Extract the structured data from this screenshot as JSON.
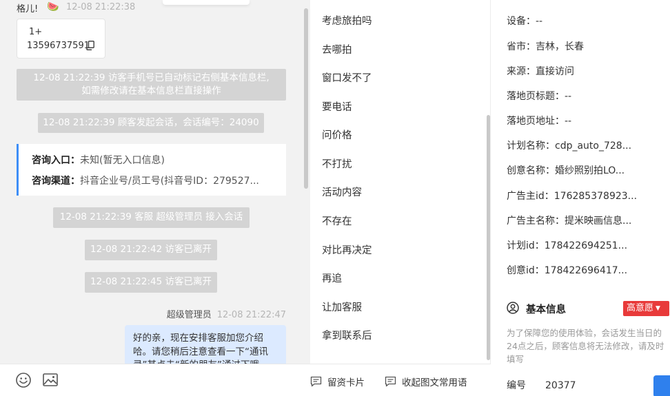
{
  "chat": {
    "visitor_name": "格儿!",
    "visitor_emoji": "🍉",
    "visitor_time": "12-08 21:22:38",
    "phone_prefix": "1+",
    "phone_number": "13596737591",
    "system_messages": [
      {
        "line1": "12-08 21:22:39 访客手机号已自动标记右侧基本信息栏,",
        "line2": "如需修改请在基本信息栏直接操作"
      },
      {
        "line1": "12-08 21:22:39 顾客发起会话，会话编号：24090"
      },
      {
        "line1": "12-08 21:22:39 客服 超级管理员 接入会话"
      },
      {
        "line1": "12-08 21:22:42 访客已离开"
      },
      {
        "line1": "12-08 21:22:45 访客已离开"
      }
    ],
    "consult": {
      "entry_label": "咨询入口：",
      "entry_value": "未知(暂无入口信息)",
      "channel_label": "咨询渠道：",
      "channel_value": "抖音企业号/员工号(抖音号ID：279527..."
    },
    "agent_name": "超级管理员",
    "agent_time": "12-08 21:22:47",
    "agent_message": "好的亲，现在安排客服加您介绍哈。请您稍后注意查看一下“通讯录”其点击“新的朋友”通过下哦"
  },
  "quick_replies": [
    "考虑旅拍吗",
    "去哪拍",
    "窗口发不了",
    "要电话",
    "问价格",
    "不打扰",
    "活动内容",
    "不存在",
    "对比再决定",
    "再追",
    "让加客服",
    "拿到联系后"
  ],
  "quick_toolbar": {
    "card_label": "留资卡片",
    "collapse_label": "收起图文常用语"
  },
  "info": {
    "rows": [
      "设备：--",
      "省市：吉林，长春",
      "来源：直接访问",
      "落地页标题：--",
      "落地页地址：--",
      "计划名称：cdp_auto_728...",
      "创意名称：婚纱照别拍LO...",
      "广告主id：176285378923...",
      "广告主名称：提米映画信息...",
      "计划id：178422694251...",
      "创意id：178422696417..."
    ],
    "section_title": "基本信息",
    "intent_label": "高意愿",
    "note": "为了保障您的使用体验，会话发生当日的24点之后，顾客信息将无法修改，请及时填写",
    "number_label": "编号",
    "number_value": "20377"
  },
  "icons": {
    "copy": "copy-icon",
    "emoji": "smile-icon",
    "image": "image-icon",
    "card": "message-square-icon",
    "collapse": "message-square-icon",
    "user": "user-circle-icon"
  },
  "colors": {
    "accent": "#3e8ef7",
    "system_bubble": "#d4d4d4",
    "agent_bubble": "#dceaff",
    "intent_badge": "#e83a3a"
  }
}
